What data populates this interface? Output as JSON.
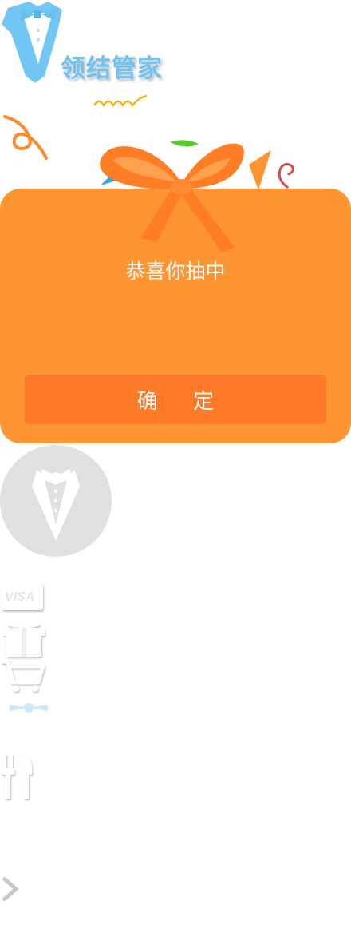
{
  "logo": {
    "text": "领结管家"
  },
  "dialog": {
    "message": "恭喜你抽中",
    "confirm_label": "确 定"
  },
  "icons": {
    "visa": "VISA"
  },
  "colors": {
    "card": "#ff9433",
    "button": "#ff7a28",
    "bow": "#ff7d24",
    "logo_blue": "#6fc3f2",
    "avatar_bg": "#e0e0e0"
  }
}
